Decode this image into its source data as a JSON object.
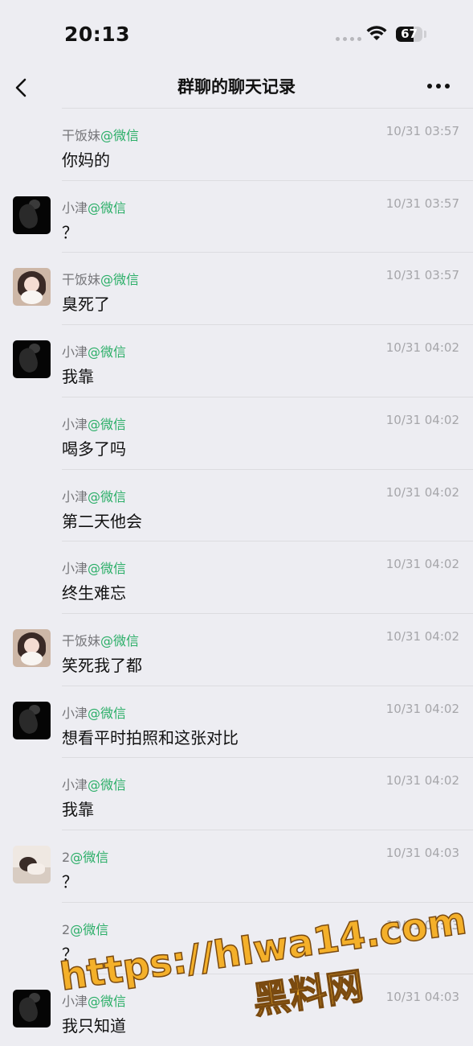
{
  "status_bar": {
    "time": "20:13",
    "battery": 67
  },
  "nav": {
    "title": "群聊的聊天记录"
  },
  "messages": [
    {
      "name": "干饭妹",
      "tag": "@微信",
      "time": "10/31 03:57",
      "text": "你妈的",
      "avatar": ""
    },
    {
      "name": "小津",
      "tag": "@微信",
      "time": "10/31 03:57",
      "text": "？",
      "avatar": "dark"
    },
    {
      "name": "干饭妹",
      "tag": "@微信",
      "time": "10/31 03:57",
      "text": "臭死了",
      "avatar": "girl"
    },
    {
      "name": "小津",
      "tag": "@微信",
      "time": "10/31 04:02",
      "text": "我靠",
      "avatar": "dark"
    },
    {
      "name": "小津",
      "tag": "@微信",
      "time": "10/31 04:02",
      "text": "喝多了吗",
      "avatar": ""
    },
    {
      "name": "小津",
      "tag": "@微信",
      "time": "10/31 04:02",
      "text": "第二天他会",
      "avatar": ""
    },
    {
      "name": "小津",
      "tag": "@微信",
      "time": "10/31 04:02",
      "text": "终生难忘",
      "avatar": ""
    },
    {
      "name": "干饭妹",
      "tag": "@微信",
      "time": "10/31 04:02",
      "text": "笑死我了都",
      "avatar": "girl"
    },
    {
      "name": "小津",
      "tag": "@微信",
      "time": "10/31 04:02",
      "text": "想看平时拍照和这张对比",
      "avatar": "dark"
    },
    {
      "name": "小津",
      "tag": "@微信",
      "time": "10/31 04:02",
      "text": "我靠",
      "avatar": ""
    },
    {
      "name": "2",
      "tag": "@微信",
      "time": "10/31 04:03",
      "text": "？",
      "avatar": "photo"
    },
    {
      "name": "2",
      "tag": "@微信",
      "time": "10/31 04:03",
      "text": "？",
      "avatar": ""
    },
    {
      "name": "小津",
      "tag": "@微信",
      "time": "10/31 04:03",
      "text": "我只知道",
      "avatar": "dark"
    }
  ],
  "watermark": {
    "line1": "https://hlwa14.com",
    "line2": "黑料网",
    "color": "#f4b02a"
  }
}
